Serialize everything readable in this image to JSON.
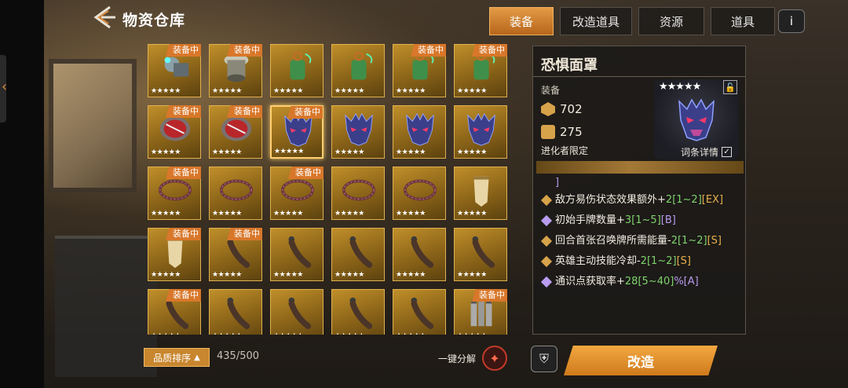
{
  "header": {
    "title": "物资仓库",
    "back_icon": "back-arrow-icon"
  },
  "tabs": [
    {
      "label": "装备",
      "active": true
    },
    {
      "label": "改造道具",
      "active": false
    },
    {
      "label": "资源",
      "active": false
    },
    {
      "label": "道具",
      "active": false
    }
  ],
  "info_label": "i",
  "colors": {
    "accent": "#d8772a",
    "cell_gold": "#c08f2a",
    "green": "#7fd36c",
    "purple": "#b89cf0"
  },
  "inventory": {
    "items": [
      {
        "icon": "mechanical-device-icon",
        "stars": "★★★★★",
        "badge": "装备中"
      },
      {
        "icon": "drum-device-icon",
        "stars": "★★★★★",
        "badge": "装备中"
      },
      {
        "icon": "green-lantern-icon",
        "stars": "★★★★★",
        "badge": ""
      },
      {
        "icon": "green-lantern-icon",
        "stars": "★★★★★",
        "badge": ""
      },
      {
        "icon": "green-lantern-icon",
        "stars": "★★★★★",
        "badge": "装备中"
      },
      {
        "icon": "green-lantern-icon",
        "stars": "★★★★★",
        "badge": "装备中"
      },
      {
        "icon": "red-drum-icon",
        "stars": "★★★★★",
        "badge": "装备中"
      },
      {
        "icon": "red-drum-icon",
        "stars": "★★★★★",
        "badge": "装备中"
      },
      {
        "icon": "demon-mask-icon",
        "stars": "★★★★★",
        "badge": "装备中",
        "selected": true
      },
      {
        "icon": "demon-mask-icon",
        "stars": "★★★★★",
        "badge": ""
      },
      {
        "icon": "demon-mask-icon",
        "stars": "★★★★★",
        "badge": ""
      },
      {
        "icon": "demon-mask-icon",
        "stars": "★★★★★",
        "badge": ""
      },
      {
        "icon": "thorn-crown-icon",
        "stars": "★★★★★",
        "badge": "装备中"
      },
      {
        "icon": "thorn-crown-icon",
        "stars": "★★★★★",
        "badge": ""
      },
      {
        "icon": "thorn-crown-icon",
        "stars": "★★★★★",
        "badge": "装备中"
      },
      {
        "icon": "thorn-crown-icon",
        "stars": "★★★★★",
        "badge": ""
      },
      {
        "icon": "thorn-crown-icon",
        "stars": "★★★★★",
        "badge": ""
      },
      {
        "icon": "cloth-talisman-icon",
        "stars": "★★★★★",
        "badge": ""
      },
      {
        "icon": "cloth-talisman-icon",
        "stars": "★★★★★",
        "badge": "装备中"
      },
      {
        "icon": "leather-strap-icon",
        "stars": "★★★★★",
        "badge": "装备中"
      },
      {
        "icon": "leather-strap-icon",
        "stars": "★★★★★",
        "badge": ""
      },
      {
        "icon": "leather-strap-icon",
        "stars": "★★★★★",
        "badge": ""
      },
      {
        "icon": "leather-strap-icon",
        "stars": "★★★★★",
        "badge": ""
      },
      {
        "icon": "leather-strap-icon",
        "stars": "★★★★★",
        "badge": ""
      },
      {
        "icon": "leather-strap-icon",
        "stars": "★★★★★",
        "badge": "装备中"
      },
      {
        "icon": "leather-strap-icon",
        "stars": "★★★★★",
        "badge": ""
      },
      {
        "icon": "leather-strap-icon",
        "stars": "★★★★★",
        "badge": ""
      },
      {
        "icon": "leather-strap-icon",
        "stars": "★★★★★",
        "badge": ""
      },
      {
        "icon": "leather-strap-icon",
        "stars": "★★★★★",
        "badge": ""
      },
      {
        "icon": "bullet-rack-icon",
        "stars": "★★★★★",
        "badge": "装备中"
      }
    ]
  },
  "detail": {
    "name": "恐惧面罩",
    "category": "装备",
    "stat1": "702",
    "stat2": "275",
    "restriction": "进化者限定",
    "preview_stars": "★★★★★",
    "lock_label": "🔓",
    "entry_details_label": "词条详情",
    "entry_checked": "✓",
    "effects_top_tail": "]",
    "effects": [
      {
        "dot": "#d6a24a",
        "text": "敌方易伤状态效果额外+",
        "val": "2",
        "range": "[1~2]",
        "tier": "[EX",
        "tier_class": "o",
        "tail": "]"
      },
      {
        "dot": "#b89cf0",
        "text": "初始手牌数量+",
        "val": "3",
        "range": "[1~5]",
        "tier": "[B]",
        "tier_class": "p",
        "tail": ""
      },
      {
        "dot": "#d6a24a",
        "text": "回合首张召唤牌所需能量-",
        "val": "2",
        "range": "[1~2]",
        "tier": "[",
        "tier_class": "o",
        "tail": "S]"
      },
      {
        "dot": "#d6a24a",
        "text": "英雄主动技能冷却-",
        "val": "2",
        "range": "[1~2]",
        "tier": "[S]",
        "tier_class": "o",
        "tail": ""
      },
      {
        "dot": "#b89cf0",
        "text": "通识点获取率+",
        "val": "28",
        "range": "[5~40]",
        "tier": "%[A]",
        "tier_class": "p",
        "tail": ""
      }
    ]
  },
  "footer": {
    "sort_label": "品质排序",
    "capacity": "435/500",
    "decompose_label": "一键分解",
    "modify_label": "改造"
  }
}
